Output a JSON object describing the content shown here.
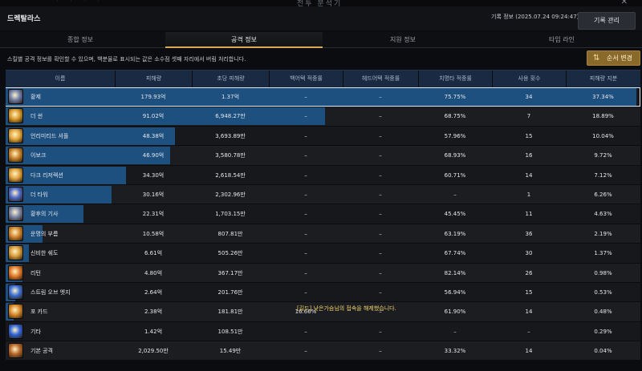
{
  "window": {
    "top_title": "전투 분석기",
    "close_glyph": "✕",
    "title": "드렉탈라스",
    "record_info": "기록 정보 (2025.07.24 09:24:47)",
    "manage_button": "기록 관리"
  },
  "tabs": [
    {
      "label": "종합 정보"
    },
    {
      "label": "공격 정보",
      "active": true
    },
    {
      "label": "지원 정보"
    },
    {
      "label": "타임 라인"
    }
  ],
  "info_text": "스킬별 공격 정보를 확인할 수 있으며, 백분율로 표시되는 값은 소수점 셋째 자리에서 버림 처리합니다.",
  "sort_button": {
    "label": "순서 변경",
    "icon": "swap-arrows-icon"
  },
  "table": {
    "headers": [
      "이름",
      "피해량",
      "초당 피해량",
      "백어택 적중률",
      "헤드어택 적중률",
      "치명타 적중률",
      "사용 횟수",
      "피해량 지분"
    ],
    "rows": [
      {
        "name": "황제",
        "damage": "179.93억",
        "dps": "1.37억",
        "back": "–",
        "head": "–",
        "crit": "75.75%",
        "uses": "34",
        "share": "37.34%",
        "bar": 1.0,
        "icon": "emperor-card-icon",
        "icon_color": "#6f7ea8"
      },
      {
        "name": "더 썬",
        "damage": "91.02억",
        "dps": "6,948.27만",
        "back": "–",
        "head": "–",
        "crit": "68.75%",
        "uses": "7",
        "share": "18.89%",
        "bar": 0.506,
        "icon": "sun-card-icon",
        "icon_color": "#d89a2a"
      },
      {
        "name": "언리미티드 셔플",
        "damage": "48.38억",
        "dps": "3,693.89만",
        "back": "–",
        "head": "–",
        "crit": "57.96%",
        "uses": "15",
        "share": "10.04%",
        "bar": 0.269,
        "icon": "unlimited-shuffle-icon",
        "icon_color": "#e3a63a"
      },
      {
        "name": "이보크",
        "damage": "46.90억",
        "dps": "3,580.78만",
        "back": "–",
        "head": "–",
        "crit": "68.93%",
        "uses": "16",
        "share": "9.72%",
        "bar": 0.261,
        "icon": "evoke-icon",
        "icon_color": "#c8832a"
      },
      {
        "name": "다크 리저렉션",
        "damage": "34.30억",
        "dps": "2,618.54만",
        "back": "–",
        "head": "–",
        "crit": "60.71%",
        "uses": "14",
        "share": "7.12%",
        "bar": 0.191,
        "icon": "dark-resurrection-icon",
        "icon_color": "#e0a23c"
      },
      {
        "name": "더 타워",
        "damage": "30.16억",
        "dps": "2,302.96만",
        "back": "–",
        "head": "–",
        "crit": "–",
        "uses": "1",
        "share": "6.26%",
        "bar": 0.168,
        "icon": "tower-card-icon",
        "icon_color": "#4e6ac8"
      },
      {
        "name": "황후의 기사",
        "damage": "22.31억",
        "dps": "1,703.15만",
        "back": "–",
        "head": "–",
        "crit": "45.45%",
        "uses": "11",
        "share": "4.63%",
        "bar": 0.124,
        "icon": "empress-knight-icon",
        "icon_color": "#7a86a8"
      },
      {
        "name": "운명의 부름",
        "damage": "10.58억",
        "dps": "807.81만",
        "back": "–",
        "head": "–",
        "crit": "63.19%",
        "uses": "36",
        "share": "2.19%",
        "bar": 0.059,
        "icon": "call-of-destiny-icon",
        "icon_color": "#d2862c"
      },
      {
        "name": "신비한 쉐도",
        "damage": "6.61억",
        "dps": "505.26만",
        "back": "–",
        "head": "–",
        "crit": "67.74%",
        "uses": "30",
        "share": "1.37%",
        "bar": 0.037,
        "icon": "mystic-shadow-icon",
        "icon_color": "#d89d3a"
      },
      {
        "name": "리턴",
        "damage": "4.80억",
        "dps": "367.17만",
        "back": "–",
        "head": "–",
        "crit": "82.14%",
        "uses": "26",
        "share": "0.98%",
        "bar": 0.027,
        "icon": "return-icon",
        "icon_color": "#e07a2a"
      },
      {
        "name": "스트림 오브 엣지",
        "damage": "2.64억",
        "dps": "201.76만",
        "back": "–",
        "head": "–",
        "crit": "56.94%",
        "uses": "15",
        "share": "0.53%",
        "bar": 0.015,
        "icon": "stream-of-edge-icon",
        "icon_color": "#3a6fd6"
      },
      {
        "name": "포 카드",
        "damage": "2.38억",
        "dps": "181.81만",
        "back": "16.66%",
        "head": "–",
        "crit": "61.90%",
        "uses": "14",
        "share": "0.48%",
        "bar": 0.013,
        "icon": "four-card-icon",
        "icon_color": "#d88a2a"
      },
      {
        "name": "기타",
        "damage": "1.42억",
        "dps": "108.51만",
        "back": "–",
        "head": "–",
        "crit": "–",
        "uses": "–",
        "share": "0.29%",
        "bar": 0.0,
        "icon": "etc-dots-icon",
        "icon_color": "#2f63d9"
      },
      {
        "name": "기본 공격",
        "damage": "2,029.50만",
        "dps": "15.49만",
        "back": "–",
        "head": "–",
        "crit": "33.32%",
        "uses": "14",
        "share": "0.04%",
        "bar": 0.0,
        "icon": "basic-attack-icon",
        "icon_color": "#b8682a"
      }
    ]
  },
  "toast": "[길드] 낮은가슴님의 접속을 해제했습니다."
}
